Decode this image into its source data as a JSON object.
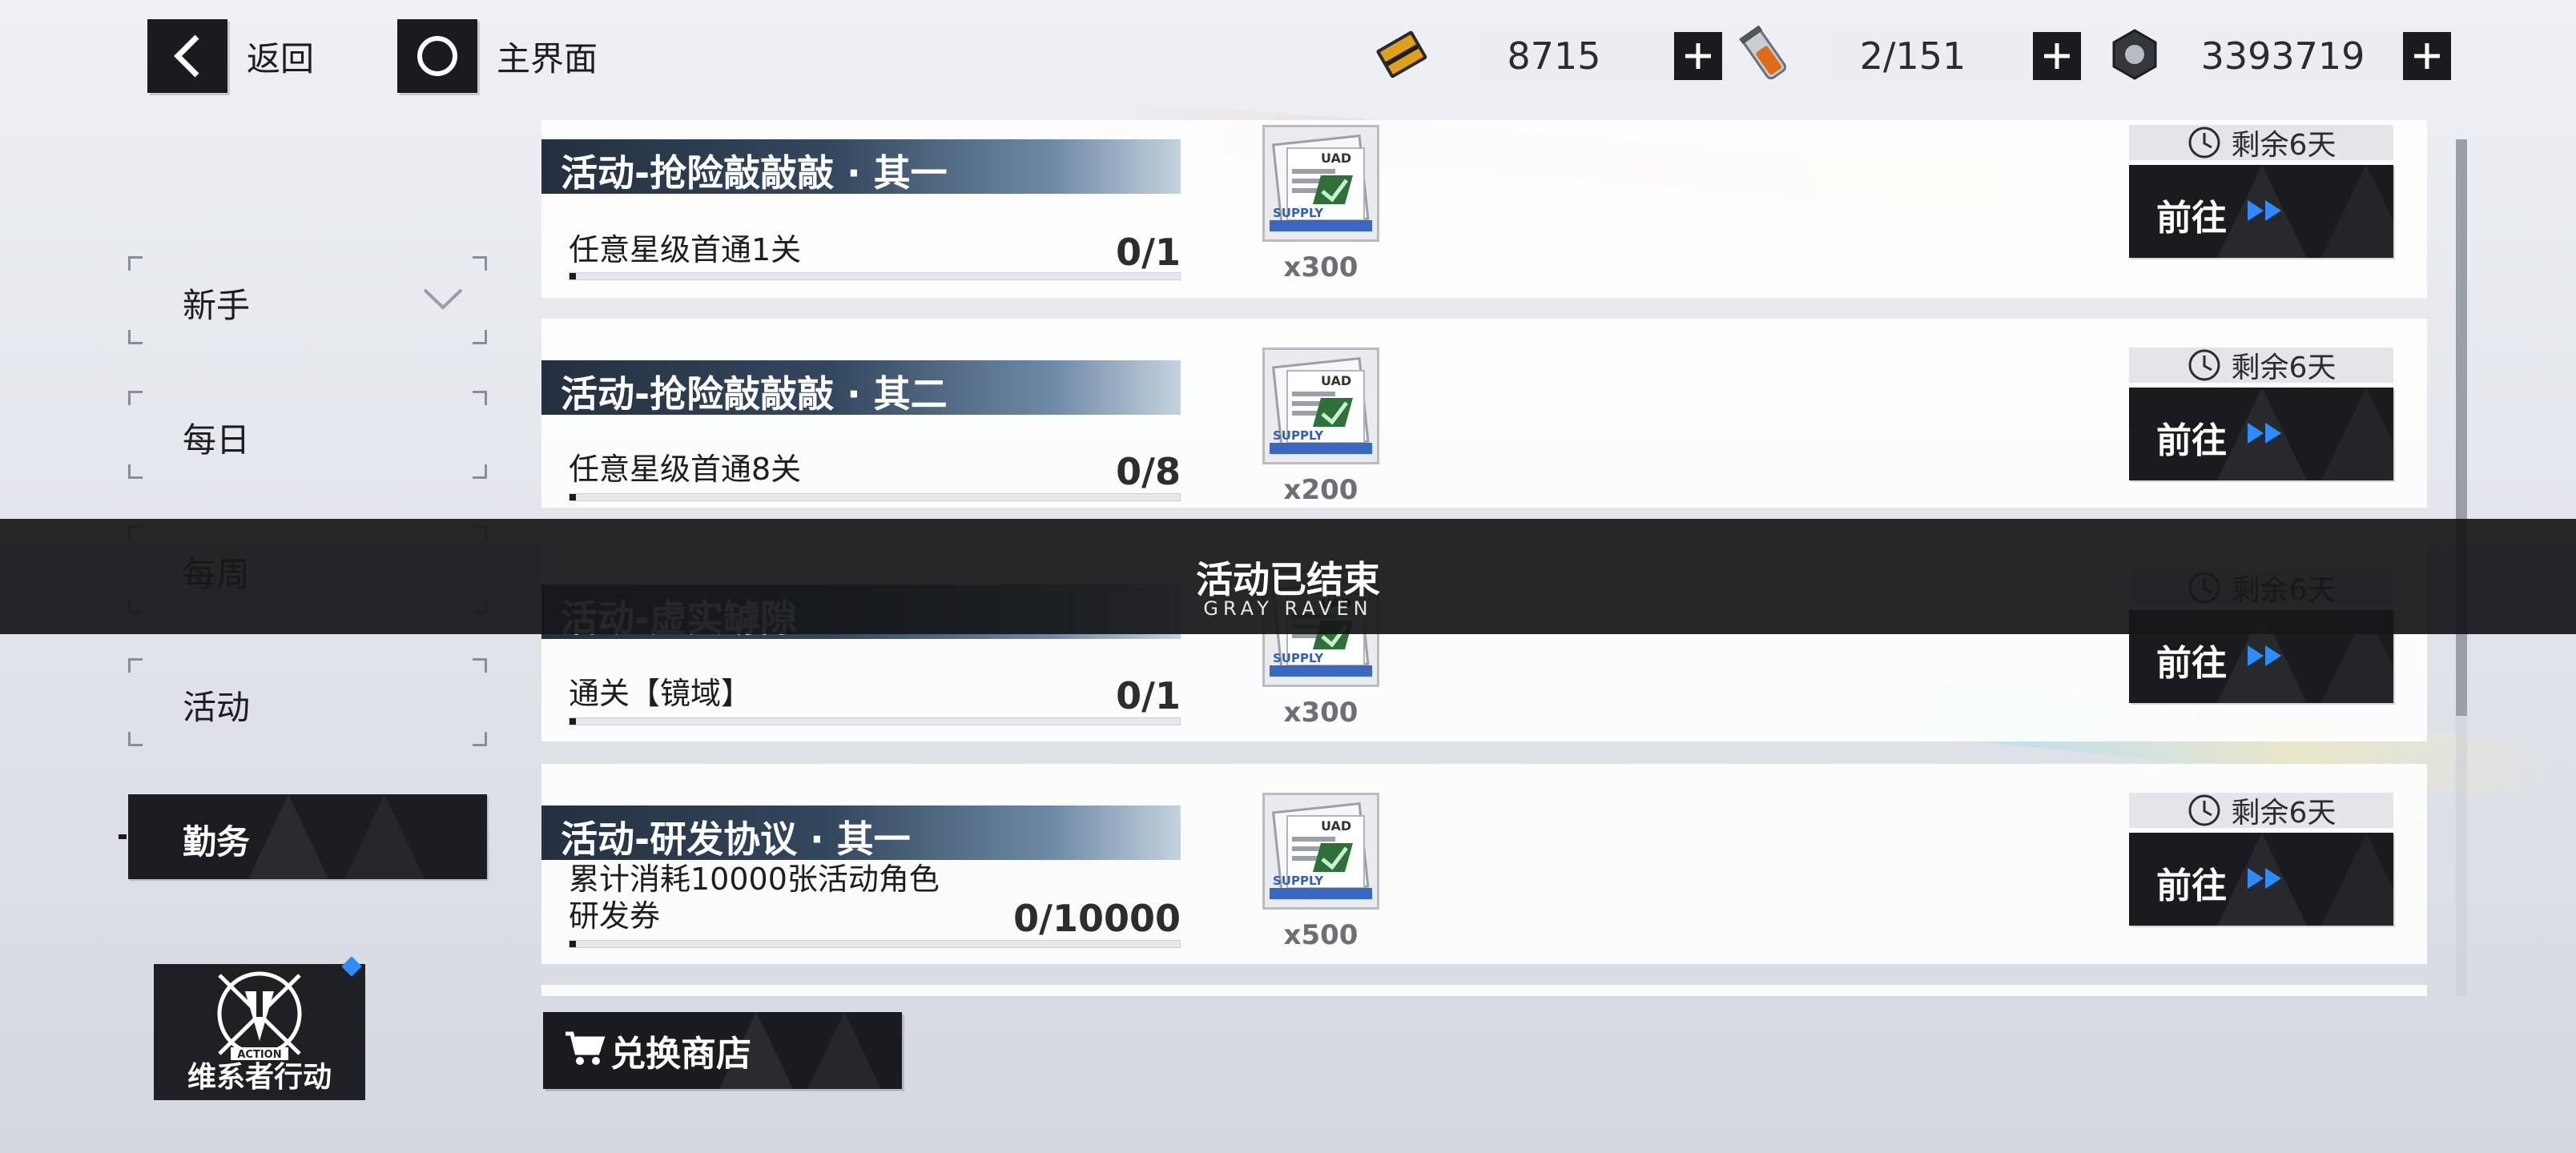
{
  "header": {
    "back_label": "返回",
    "home_label": "主界面",
    "resources": [
      {
        "icon": "gold-card-icon",
        "value": "8715"
      },
      {
        "icon": "energy-vial-icon",
        "value": "2/151"
      },
      {
        "icon": "nut-currency-icon",
        "value": "3393719"
      }
    ]
  },
  "sidebar": {
    "items": [
      {
        "label": "新手"
      },
      {
        "label": "每日"
      },
      {
        "label": "每周"
      },
      {
        "label": "活动"
      },
      {
        "label": "勤务"
      }
    ],
    "active": "勤务"
  },
  "tasks": [
    {
      "title": "活动-抢险敲敲敲 · 其一",
      "desc": "任意星级首通1关",
      "progress": "0/1",
      "progress_fraction": 0,
      "reward_qty": "x300",
      "remaining": "剩余6天",
      "go_label": "前往"
    },
    {
      "title": "活动-抢险敲敲敲 · 其二",
      "desc": "任意星级首通8关",
      "progress": "0/8",
      "progress_fraction": 0,
      "reward_qty": "x200",
      "remaining": "剩余6天",
      "go_label": "前往"
    },
    {
      "title": "活动-虚实罅隙",
      "desc": "通关【镜域】",
      "progress": "0/1",
      "progress_fraction": 0,
      "reward_qty": "x300",
      "remaining": "剩余6天",
      "go_label": "前往"
    },
    {
      "title": "活动-研发协议 · 其一",
      "desc_line1": "累计消耗10000张活动角色",
      "desc_line2": "研发券",
      "progress": "0/10000",
      "progress_fraction": 0,
      "reward_qty": "x500",
      "remaining": "剩余6天",
      "go_label": "前往"
    }
  ],
  "reward_item": {
    "icon": "supply-pack-icon",
    "brand": "UAD",
    "band_text": "SUPPLY"
  },
  "ended_banner": {
    "title": "活动已结束",
    "subtitle": "GRAY RAVEN"
  },
  "shop_button": {
    "label": "兑换商店"
  },
  "logo": {
    "text": "维系者行动",
    "emblem_text": "ACTION"
  },
  "colors": {
    "accent_blue": "#2e8cff",
    "dark": "#1a1b1e",
    "title_band": "#33475e"
  }
}
